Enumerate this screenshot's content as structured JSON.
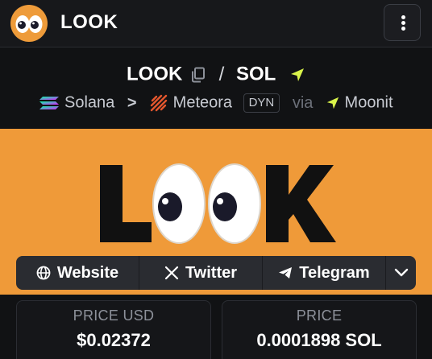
{
  "header": {
    "title": "LOOK",
    "avatar_icon": "googly-eyes-logo",
    "menu_icon": "vertical-dots-icon"
  },
  "pair": {
    "base": "LOOK",
    "separator": "/",
    "quote": "SOL"
  },
  "route": {
    "chain": "Solana",
    "dex": "Meteora",
    "badge": "DYN",
    "via": "via",
    "launchpad": "Moonit"
  },
  "banner": {
    "text": "LOOK",
    "background": "#ef9a39"
  },
  "links": {
    "website": "Website",
    "twitter": "Twitter",
    "telegram": "Telegram"
  },
  "prices": {
    "usd_label": "PRICE USD",
    "usd_value": "$0.02372",
    "native_label": "PRICE",
    "native_value": "0.0001898 SOL"
  },
  "colors": {
    "accent_moonit": "#d9f34a",
    "banner_orange": "#ef9a39",
    "meteora": "#e4572e"
  }
}
